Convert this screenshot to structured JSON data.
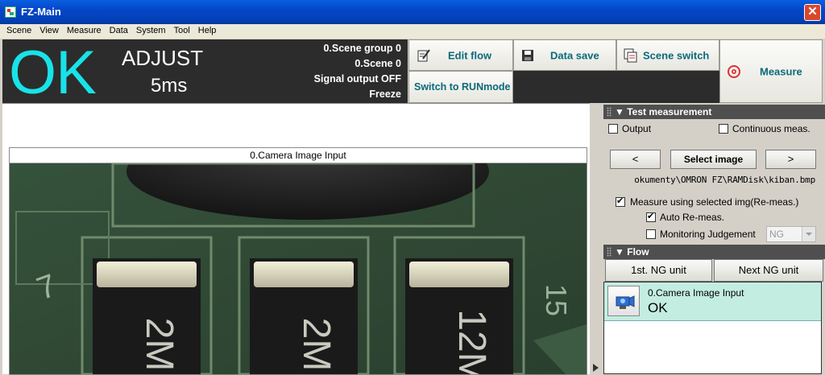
{
  "window": {
    "title": "FZ-Main"
  },
  "menu": [
    "Scene",
    "View",
    "Measure",
    "Data",
    "System",
    "Tool",
    "Help"
  ],
  "status": {
    "result": "OK",
    "mode": "ADJUST",
    "time": "5ms",
    "scene_group": "0.Scene group 0",
    "scene": "0.Scene 0",
    "signal_output": "Signal output OFF",
    "freeze": "Freeze",
    "result_color": "#18e3e8"
  },
  "toolbar": {
    "edit_flow": "Edit flow",
    "data_save": "Data save",
    "scene_switch": "Scene switch",
    "measure": "Measure",
    "switch_runmode": "Switch to RUNmode"
  },
  "image_panel": {
    "title": "0.Camera Image Input"
  },
  "test_measurement": {
    "header": "Test measurement",
    "output_label": "Output",
    "continuous_label": "Continuous meas.",
    "prev": "<",
    "select_image": "Select image",
    "next": ">",
    "path": "okumenty\\OMRON FZ\\RAMDisk\\kiban.bmp",
    "measure_selected": "Measure using selected img(Re-meas.)",
    "auto_remeas": "Auto Re-meas.",
    "monitoring": "Monitoring Judgement",
    "monitoring_value": "NG"
  },
  "flow": {
    "header": "Flow",
    "first_ng": "1st. NG unit",
    "next_ng": "Next NG unit",
    "items": [
      {
        "name": "0.Camera Image Input",
        "result": "OK"
      }
    ]
  }
}
